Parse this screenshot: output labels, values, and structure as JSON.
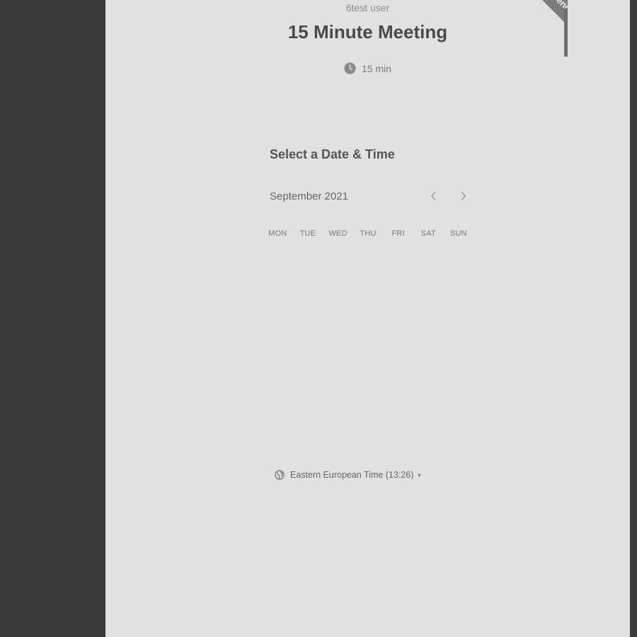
{
  "host": {
    "name": "6test user"
  },
  "event": {
    "title": "15 Minute Meeting",
    "duration": "15 min",
    "duration_icon": "clock-icon"
  },
  "scheduler": {
    "section_title": "Select a Date & Time",
    "month_label": "September 2021",
    "prev_icon": "chevron-left-icon",
    "next_icon": "chevron-right-icon",
    "weekdays": [
      "MON",
      "TUE",
      "WED",
      "THU",
      "FRI",
      "SAT",
      "SUN"
    ]
  },
  "timezone": {
    "label": "Eastern European Time (13:26)",
    "icon": "globe-icon",
    "caret": "▾"
  },
  "badge": {
    "small_text": "POWERED BY",
    "brand": "Calendly"
  },
  "colors": {
    "panel_bg": "#e1e1e1",
    "outer_bg": "#3a3a3a",
    "ribbon_bg": "#7b7b7b"
  }
}
